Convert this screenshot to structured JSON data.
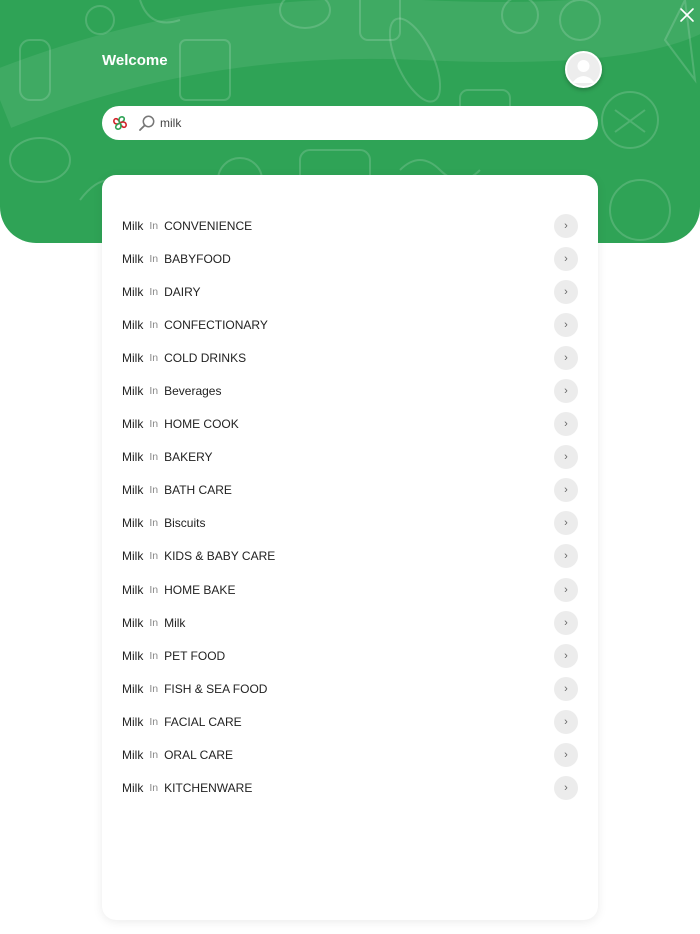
{
  "header": {
    "welcome": "Welcome",
    "background_color": "#2fa356"
  },
  "icons": {
    "close": "close-icon",
    "avatar": "user-avatar-icon",
    "logo": "store-logo",
    "search": "search-icon",
    "chevron": "chevron-right-icon"
  },
  "search": {
    "value": "milk",
    "placeholder": ""
  },
  "suggestions": {
    "connector": "In",
    "chevron_glyph": "›",
    "items": [
      {
        "term": "Milk",
        "category": "CONVENIENCE"
      },
      {
        "term": "Milk",
        "category": "BABYFOOD"
      },
      {
        "term": "Milk",
        "category": "DAIRY"
      },
      {
        "term": "Milk",
        "category": "CONFECTIONARY"
      },
      {
        "term": "Milk",
        "category": "COLD DRINKS"
      },
      {
        "term": "Milk",
        "category": "Beverages"
      },
      {
        "term": "Milk",
        "category": "HOME COOK"
      },
      {
        "term": "Milk",
        "category": "BAKERY"
      },
      {
        "term": "Milk",
        "category": "BATH CARE"
      },
      {
        "term": "Milk",
        "category": "Biscuits"
      },
      {
        "term": "Milk",
        "category": "KIDS & BABY CARE"
      },
      {
        "term": "Milk",
        "category": "HOME BAKE"
      },
      {
        "term": "Milk",
        "category": "Milk"
      },
      {
        "term": "Milk",
        "category": "PET FOOD"
      },
      {
        "term": "Milk",
        "category": "FISH & SEA FOOD"
      },
      {
        "term": "Milk",
        "category": "FACIAL CARE"
      },
      {
        "term": "Milk",
        "category": "ORAL CARE"
      },
      {
        "term": "Milk",
        "category": "KITCHENWARE"
      }
    ]
  }
}
